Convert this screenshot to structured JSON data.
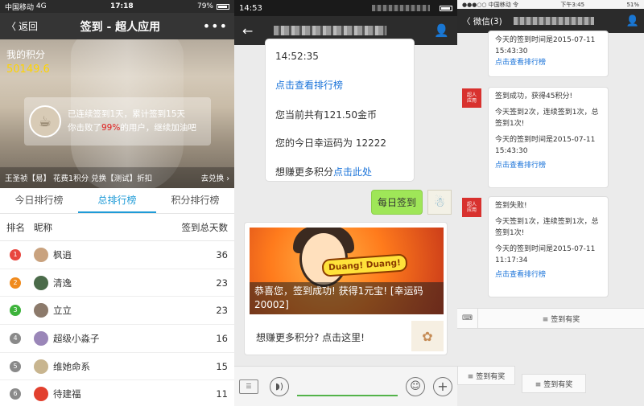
{
  "panel1": {
    "status": {
      "carrier": "中国移动",
      "network": "4G",
      "time": "17:18",
      "battery": "79%"
    },
    "nav": {
      "back": "返回",
      "title": "签到 - 超人应用",
      "more": "•••"
    },
    "hero": {
      "points_label": "我的积分",
      "points_value": "50149.6",
      "streak_line": "已连续签到1天，累计签到15天",
      "beat_prefix": "你击败了",
      "beat_value": "99%",
      "beat_suffix": "的用户，继续加油吧",
      "promo": "王圣祯【易】 花费1积分 兑换【测试】折扣",
      "redeem": "去兑换"
    },
    "tabs": [
      "今日排行榜",
      "总排行榜",
      "积分排行榜"
    ],
    "table": {
      "headers": {
        "rank": "排名",
        "nickname": "昵称",
        "total_days": "签到总天数"
      },
      "rows": [
        {
          "rank": "1",
          "name": "枫逍",
          "days": "36",
          "badge": "#e8473f",
          "avatar": "#c9a27e"
        },
        {
          "rank": "2",
          "name": "清逸",
          "days": "23",
          "badge": "#f08a1c",
          "avatar": "#4b6b4a"
        },
        {
          "rank": "3",
          "name": "立立",
          "days": "23",
          "badge": "#3db33b",
          "avatar": "#8c7a6b"
        },
        {
          "rank": "4",
          "name": "超级小淼子",
          "days": "16",
          "badge": "#8a8a8a",
          "avatar": "#9a86b8"
        },
        {
          "rank": "5",
          "name": "维她命系",
          "days": "15",
          "badge": "#8a8a8a",
          "avatar": "#c8b58f"
        },
        {
          "rank": "6",
          "name": "待建福",
          "days": "11",
          "badge": "#8a8a8a",
          "avatar": "#e2402e"
        }
      ]
    }
  },
  "panel2": {
    "status": {
      "time": "14:53"
    },
    "bubble": {
      "time_line": "14:52:35",
      "rank_link": "点击查看排行榜",
      "coins": "您当前共有121.50金币",
      "lucky": "您的今日幸运码为 12222",
      "more_prefix": "想赚更多积分",
      "more_link": "点击此处"
    },
    "sent": "每日签到",
    "news": {
      "banner": "Duang! Duang!",
      "caption": "恭喜您，签到成功! 获得1元宝! [幸运码20002]",
      "more": "想赚更多积分? 点击这里!"
    },
    "input": {
      "keyboard": "☰",
      "voice": "◗)",
      "emoji": "☺",
      "plus": "+"
    }
  },
  "panel3": {
    "status": {
      "carrier": "●●●○○ 中国移动 令",
      "time": "下午3:45",
      "battery": "51%"
    },
    "nav": {
      "back": "〈 微信(3)",
      "person": "👤"
    },
    "msg1": {
      "line1": "今天的签到时间是2015-07-11",
      "line2": "15:43:30",
      "link": "点击查看排行榜"
    },
    "msg2": {
      "line1": "签到成功，获得45积分!",
      "line2": "今天签到2次，连续签到1次，总签到1次!",
      "line3": "今天的签到时间是2015-07-11",
      "line4": "15:43:30",
      "link": "点击查看排行榜"
    },
    "msg3": {
      "line1": "签到失败!",
      "line2": "今天签到1次，连续签到1次，总签到1次!",
      "line3": "今天的签到时间是2015-07-11",
      "line4": "11:17:34",
      "link": "点击查看排行榜"
    },
    "menu": {
      "keyboard": "⌨",
      "item": "≡ 签到有奖"
    },
    "menu_bottom_left": "≡ 签到有奖",
    "menu_bottom_right": "≡ 签到有奖"
  }
}
